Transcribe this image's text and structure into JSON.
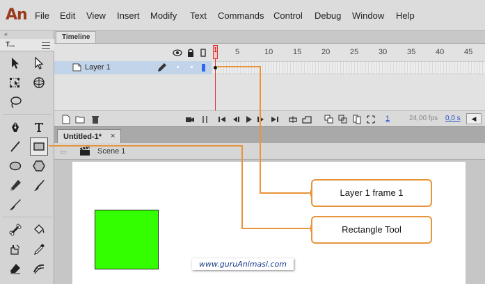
{
  "app": {
    "logo": "An"
  },
  "menu": [
    "File",
    "Edit",
    "View",
    "Insert",
    "Modify",
    "Text",
    "Commands",
    "Control",
    "Debug",
    "Window",
    "Help"
  ],
  "tools_panel": {
    "collapse": "«",
    "title": "T..."
  },
  "tools": [
    "selection-tool",
    "subselection-tool",
    "free-transform-tool",
    "3d-rotation-tool",
    "lasso-tool",
    "pen-tool",
    "text-tool",
    "line-tool",
    "rectangle-tool",
    "oval-tool",
    "polystar-tool",
    "pencil-tool",
    "brush-tool",
    "paint-brush-tool",
    "bone-tool",
    "paint-bucket-tool",
    "ink-bottle-tool",
    "eyedropper-tool",
    "eraser-tool",
    "width-tool"
  ],
  "timeline": {
    "tab_label": "Timeline",
    "frame_numbers": [
      "5",
      "10",
      "15",
      "20",
      "25",
      "30",
      "35",
      "40",
      "45"
    ],
    "playhead_frame": "1",
    "layer": {
      "name": "Layer 1"
    },
    "current_frame": "1",
    "fps": "24,00 fps",
    "elapsed": "0,0 s"
  },
  "document": {
    "tab_title": "Untitled-1*",
    "close": "×",
    "back": "⇦",
    "scene": "Scene 1"
  },
  "watermark": "www.guruAnimasi.com",
  "callouts": {
    "layer_frame": "Layer 1 frame 1",
    "rectangle_tool": "Rectangle Tool"
  },
  "colors": {
    "shape_fill": "#33ff00",
    "callout_border": "#e8943a",
    "playhead": "#e03030",
    "layer_highlight": "#c2d4ea"
  }
}
